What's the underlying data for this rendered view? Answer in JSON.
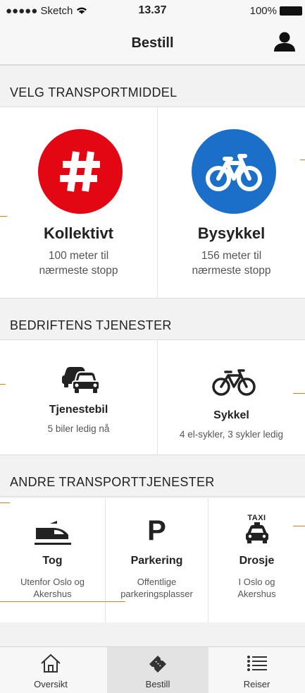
{
  "status_bar": {
    "carrier": "●●●●● Sketch",
    "time": "13.37",
    "battery": "100%"
  },
  "nav": {
    "title": "Bestill"
  },
  "sections": {
    "transport": {
      "header": "VELG TRANSPORTMIDDEL",
      "items": [
        {
          "title": "Kollektivt",
          "sub1": "100 meter til",
          "sub2": "nærmeste stopp",
          "icon": "hash-icon",
          "color": "#e30613"
        },
        {
          "title": "Bysykkel",
          "sub1": "156 meter til",
          "sub2": "nærmeste stopp",
          "icon": "bicycle-icon",
          "color": "#1c6fc9"
        }
      ]
    },
    "company": {
      "header": "BEDRIFTENS TJENESTER",
      "items": [
        {
          "title": "Tjenestebil",
          "sub": "5 biler ledig nå",
          "icon": "cars-icon"
        },
        {
          "title": "Sykkel",
          "sub": "4 el-sykler, 3 sykler ledig",
          "icon": "bicycle-icon"
        }
      ]
    },
    "other": {
      "header": "ANDRE TRANSPORTTJENESTER",
      "items": [
        {
          "title": "Tog",
          "sub1": "Utenfor Oslo og",
          "sub2": "Akershus",
          "icon": "train-icon"
        },
        {
          "title": "Parkering",
          "sub1": "Offentlige",
          "sub2": "parkeringsplasser",
          "icon": "parking-icon",
          "glyph": "P"
        },
        {
          "title": "Drosje",
          "sub1": "I Oslo og",
          "sub2": "Akershus",
          "icon": "taxi-icon",
          "glyph": "TAXI"
        }
      ]
    }
  },
  "tabs": [
    {
      "label": "Oversikt",
      "icon": "home-icon"
    },
    {
      "label": "Bestill",
      "icon": "ticket-icon",
      "active": true
    },
    {
      "label": "Reiser",
      "icon": "list-icon"
    }
  ]
}
